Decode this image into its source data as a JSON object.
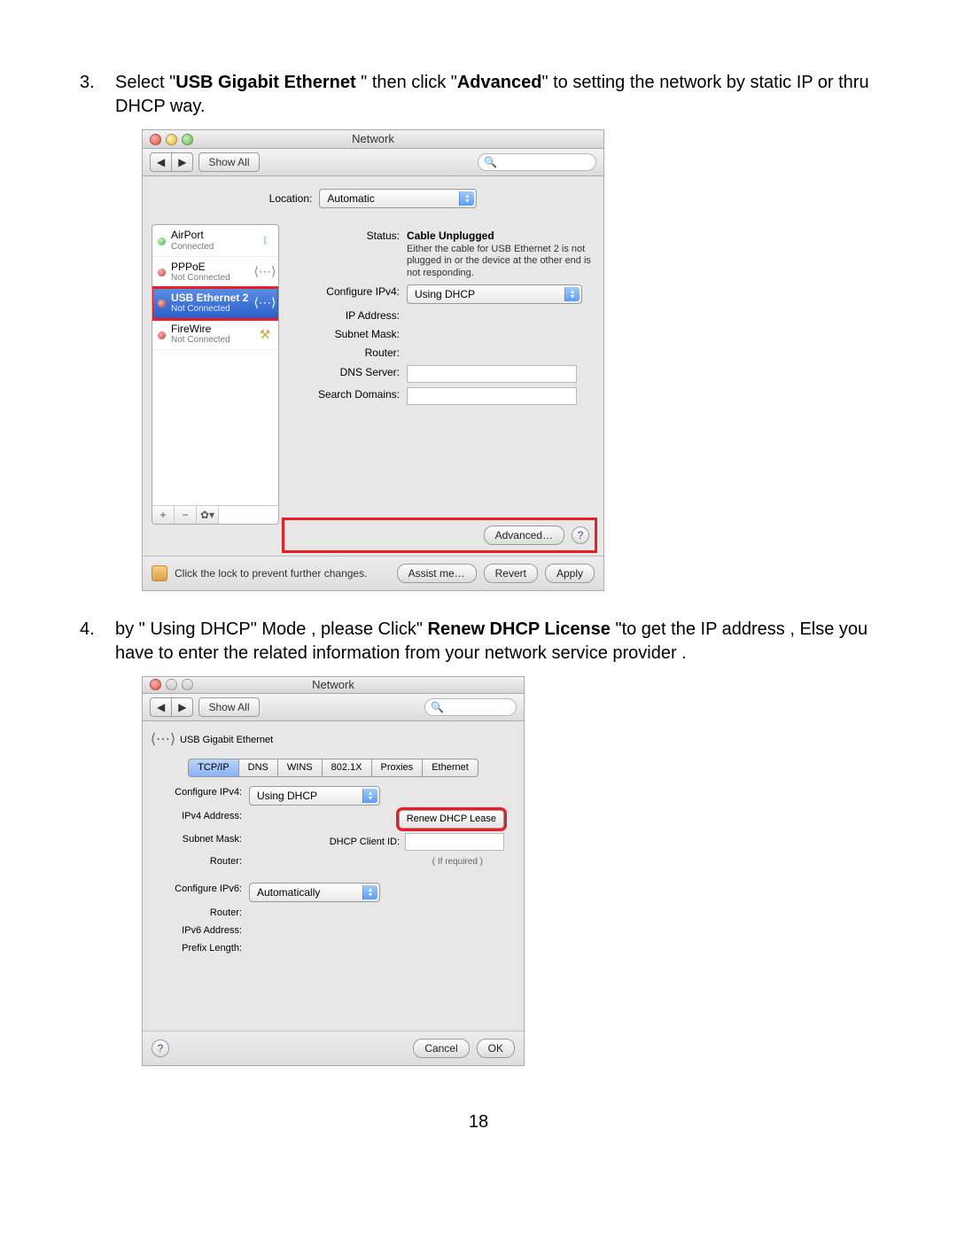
{
  "page_number": "18",
  "step3": {
    "num": "3.",
    "t1": "Select \"",
    "b1": "USB Gigabit Ethernet",
    "t2": " \" then click \"",
    "b2": "Advanced",
    "t3": "\" to setting the network by static IP or thru DHCP way."
  },
  "step4": {
    "num": "4.",
    "t1": "by \" Using DHCP\" Mode , please Click\" ",
    "b1": "Renew DHCP License ",
    "t2": "\"to get the IP address , Else you have to enter the related information from your network service provider ."
  },
  "s1": {
    "title": "Network",
    "showall": "Show All",
    "location_label": "Location:",
    "location_value": "Automatic",
    "services": [
      {
        "name": "AirPort",
        "sub": "Connected",
        "status": "green",
        "icon": "wifi"
      },
      {
        "name": "PPPoE",
        "sub": "Not Connected",
        "status": "red",
        "icon": "dots"
      },
      {
        "name": "USB Ethernet 2",
        "sub": "Not Connected",
        "status": "red",
        "icon": "eth",
        "sel": true
      },
      {
        "name": "FireWire",
        "sub": "Not Connected",
        "status": "red",
        "icon": "fw"
      }
    ],
    "status_label": "Status:",
    "status_value": "Cable Unplugged",
    "status_desc": "Either the cable for USB Ethernet 2 is not plugged in or the device at the other end is not responding.",
    "configure_label": "Configure IPv4:",
    "configure_value": "Using DHCP",
    "fields": [
      "IP Address:",
      "Subnet Mask:",
      "Router:",
      "DNS Server:",
      "Search Domains:"
    ],
    "advanced": "Advanced…",
    "lock_msg": "Click the lock to prevent further changes.",
    "assist": "Assist me…",
    "revert": "Revert",
    "apply": "Apply"
  },
  "s2": {
    "title": "Network",
    "showall": "Show All",
    "service": "USB Gigabit Ethernet",
    "tabs": [
      "TCP/IP",
      "DNS",
      "WINS",
      "802.1X",
      "Proxies",
      "Ethernet"
    ],
    "cfg4_label": "Configure IPv4:",
    "cfg4_value": "Using DHCP",
    "ipv4_label": "IPv4 Address:",
    "mask_label": "Subnet Mask:",
    "router_label": "Router:",
    "renew": "Renew DHCP Lease",
    "client_label": "DHCP Client ID:",
    "client_note": "( If required )",
    "cfg6_label": "Configure IPv6:",
    "cfg6_value": "Automatically",
    "router6_label": "Router:",
    "ipv6_label": "IPv6 Address:",
    "plen_label": "Prefix Length:",
    "cancel": "Cancel",
    "ok": "OK"
  }
}
